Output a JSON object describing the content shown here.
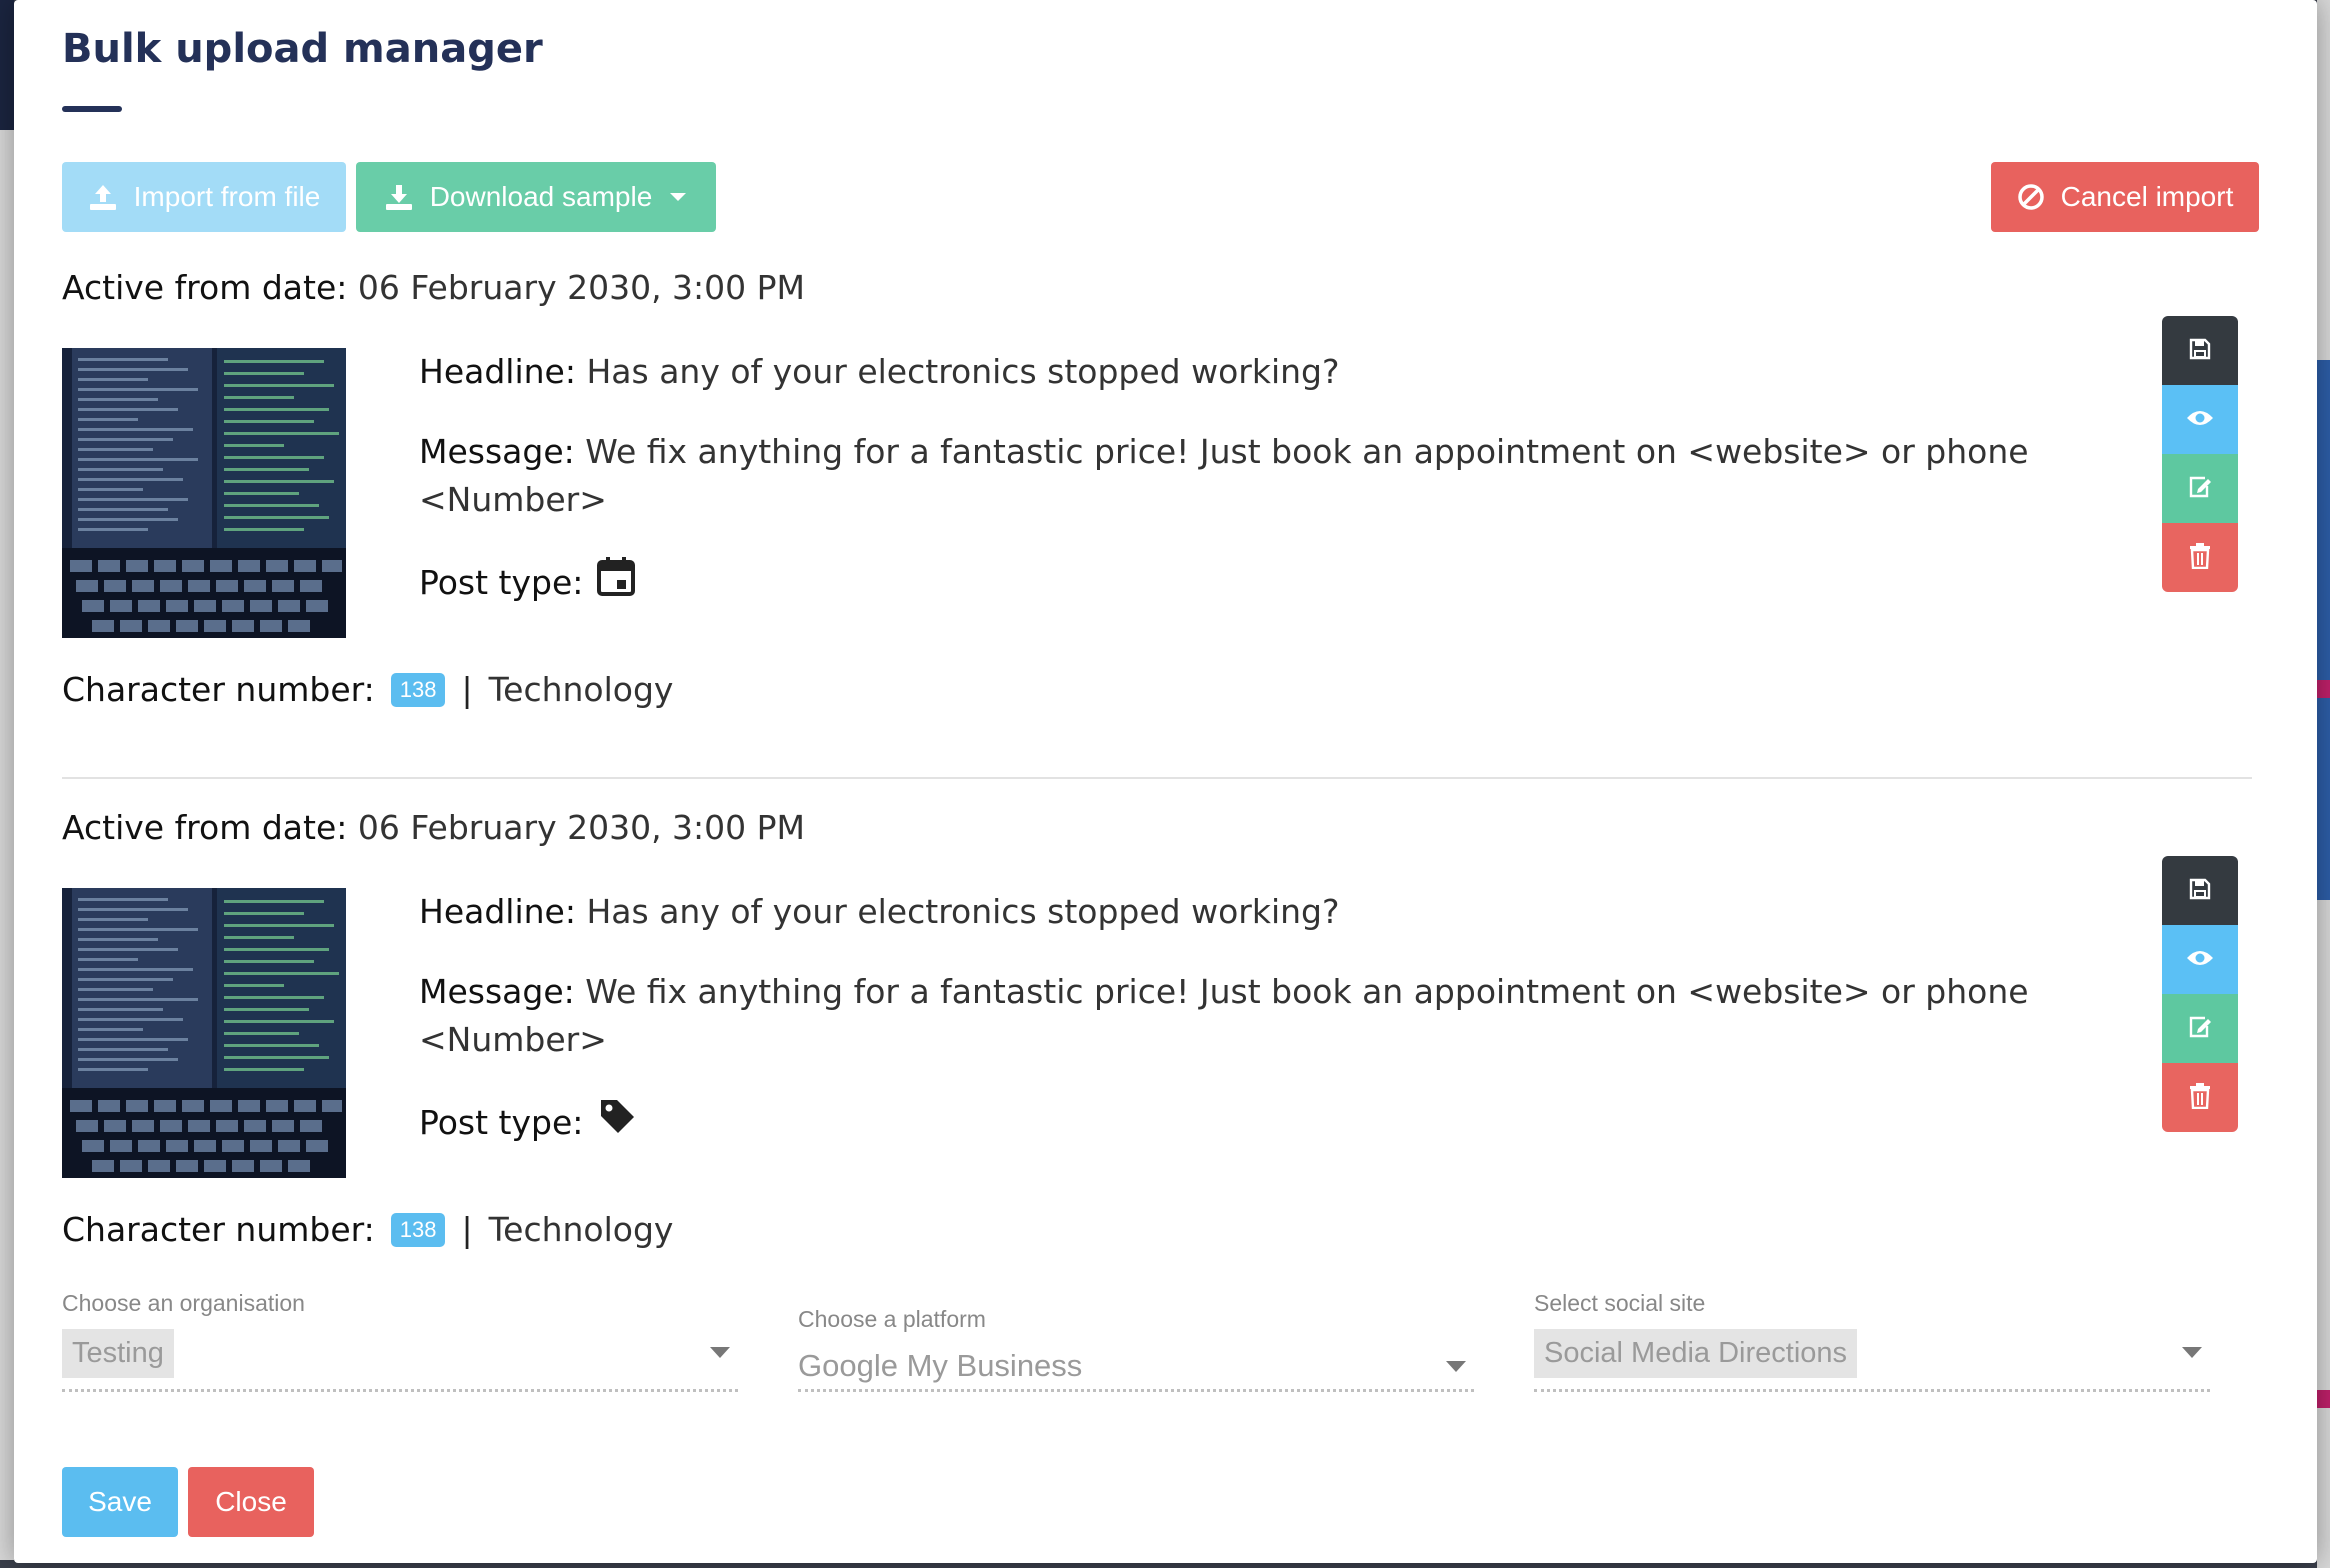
{
  "modal": {
    "title": "Bulk upload manager"
  },
  "toolbar": {
    "import_label": "Import from file",
    "download_label": "Download sample",
    "cancel_label": "Cancel import"
  },
  "posts": [
    {
      "active_label": "Active from date:",
      "active_value": "06 February 2030, 3:00 PM",
      "headline_label": "Headline:",
      "headline_value": "Has any of your electronics stopped working?",
      "message_label": "Message:",
      "message_value": "We fix anything for a fantastic price! Just book an appointment on <website> or phone <Number>",
      "post_type_label": "Post type:",
      "post_type_icon": "calendar-event-icon",
      "char_label": "Character number:",
      "char_count": "138",
      "separator": "|",
      "category": "Technology"
    },
    {
      "active_label": "Active from date:",
      "active_value": "06 February 2030, 3:00 PM",
      "headline_label": "Headline:",
      "headline_value": "Has any of your electronics stopped working?",
      "message_label": "Message:",
      "message_value": "We fix anything for a fantastic price! Just book an appointment on <website> or phone <Number>",
      "post_type_label": "Post type:",
      "post_type_icon": "tag-icon",
      "char_label": "Character number:",
      "char_count": "138",
      "separator": "|",
      "category": "Technology"
    }
  ],
  "filters": {
    "organisation_label": "Choose an organisation",
    "organisation_value": "Testing",
    "platform_label": "Choose a platform",
    "platform_value": "Google My Business",
    "social_label": "Select social site",
    "social_value": "Social Media Directions"
  },
  "footer": {
    "save_label": "Save",
    "close_label": "Close"
  },
  "colors": {
    "title": "#243158",
    "import_button": "#a3dcf7",
    "download_button": "#69cda8",
    "cancel_button": "#e8625e",
    "badge": "#5bbdf0"
  }
}
